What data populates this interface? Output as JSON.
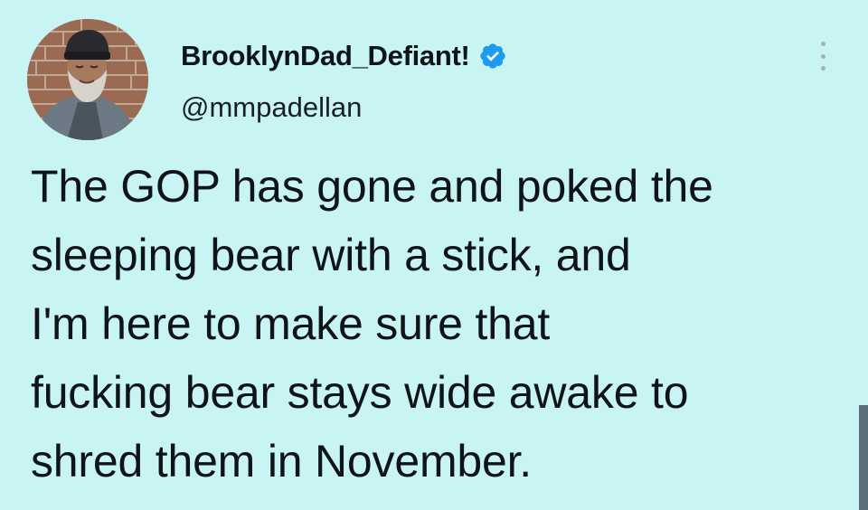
{
  "colors": {
    "background": "#c9f4f4",
    "text": "#0f1419",
    "verified_badge": "#1d9bf0"
  },
  "author": {
    "display_name": "BrooklynDad_Defiant!",
    "handle": "@mmpadellan",
    "verified_icon": "verified-badge-icon",
    "avatar_icon": "profile-photo"
  },
  "menu": {
    "icon": "more-vertical-icon"
  },
  "tweet": {
    "lines": [
      "The GOP has gone and poked the",
      "sleeping bear with a stick, and",
      "I'm here to make sure that",
      "fucking bear stays wide awake to",
      "shred them in November."
    ]
  }
}
